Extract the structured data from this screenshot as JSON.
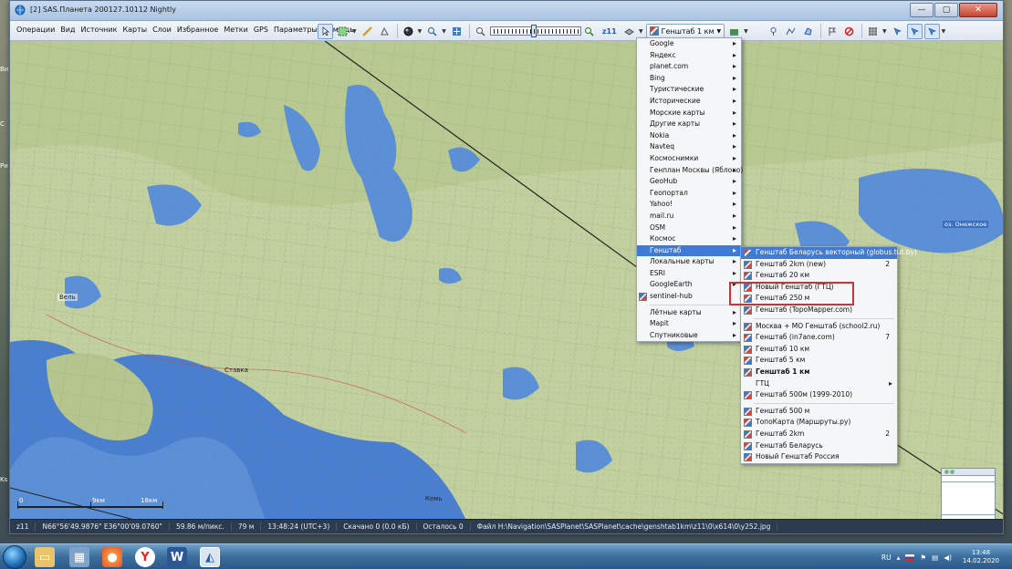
{
  "window": {
    "title": "[2] SAS.Планета 200127.10112 Nightly",
    "controls": {
      "minimize": "—",
      "maximize": "▢",
      "close": "✕"
    }
  },
  "menubar": [
    "Операции",
    "Вид",
    "Источник",
    "Карты",
    "Слои",
    "Избранное",
    "Метки",
    "GPS",
    "Параметры",
    "Помощь"
  ],
  "toolbar": {
    "zoom_label": "z11",
    "zoom_level_fraction": 0.47,
    "current_map": "Генштаб 1 км"
  },
  "desktop_edge_labels": [
    "Ви",
    "С",
    "Ри",
    "Ks"
  ],
  "map": {
    "place_labels": [
      "Вель",
      "Ставка",
      "оз. Онежское",
      "Кемь"
    ],
    "scale_labels": [
      "0",
      "9км",
      "18км"
    ],
    "colors": {
      "land": "#b8c79a",
      "water": "#5b8fd6",
      "sea": "#4a7fcf"
    }
  },
  "statusbar": [
    "z11",
    "N66°56'49.9876\" E36°00'09.0760\"",
    "59.86 м/пикс.",
    "79 м",
    "13:48:24 (UTC+3)",
    "Скачано 0 (0.0 кБ)",
    "Осталось 0",
    "Файл H:\\Navigation\\SASPlanet\\SASPlanet\\cache\\genshtab1km\\z11\\0\\x614\\0\\y252.jpg"
  ],
  "main_menu": [
    {
      "label": "Google",
      "sub": true
    },
    {
      "label": "Яндекс",
      "sub": true
    },
    {
      "label": "planet.com",
      "sub": true
    },
    {
      "label": "Bing",
      "sub": true
    },
    {
      "label": "Туристические",
      "sub": true
    },
    {
      "label": "Исторические",
      "sub": true
    },
    {
      "label": "Морские карты",
      "sub": true
    },
    {
      "label": "Другие карты",
      "sub": true
    },
    {
      "label": "Nokia",
      "sub": true
    },
    {
      "label": "Navteq",
      "sub": true
    },
    {
      "label": "Космоснимки",
      "sub": true
    },
    {
      "label": "Генплан Москвы (Яблоко)",
      "sub": true
    },
    {
      "label": "GeoHub",
      "sub": true
    },
    {
      "label": "Геопортал",
      "sub": true
    },
    {
      "label": "Yahoo!",
      "sub": true
    },
    {
      "label": "mail.ru",
      "sub": true
    },
    {
      "label": "OSM",
      "sub": true
    },
    {
      "label": "Космос",
      "sub": true
    },
    {
      "label": "Генштаб",
      "sub": true,
      "highlighted": true
    },
    {
      "label": "Локальные карты",
      "sub": true
    },
    {
      "label": "ESRI",
      "sub": true
    },
    {
      "label": "GoogleEarth",
      "sub": true
    },
    {
      "label": "sentinel-hub",
      "sub": false,
      "icon": true
    },
    {
      "separator": true
    },
    {
      "label": "Лётные карты",
      "sub": true
    },
    {
      "label": "Mapit",
      "sub": true
    },
    {
      "label": "Спутниковые",
      "sub": true
    }
  ],
  "sub_menu": [
    {
      "label": "Генштаб Беларусь векторный (globus.tut.by)",
      "highlighted": true
    },
    {
      "label": "Генштаб 2km (new)",
      "shortcut": "2"
    },
    {
      "label": "Генштаб 20 км"
    },
    {
      "label": "Новый Генштаб (ГТЦ)"
    },
    {
      "label": "Генштаб 250 м"
    },
    {
      "label": "Генштаб (TopoMapper.com)"
    },
    {
      "separator": true
    },
    {
      "label": "Москва + МО Генштаб (school2.ru)"
    },
    {
      "label": "Генштаб (in7ane.com)",
      "shortcut": "7"
    },
    {
      "label": "Генштаб 10 км"
    },
    {
      "label": "Генштаб 5 км"
    },
    {
      "label": "Генштаб 1 км",
      "bold": true
    },
    {
      "label": "ГТЦ",
      "sub": true,
      "noicon": true
    },
    {
      "label": "Генштаб 500м (1999-2010)"
    },
    {
      "separator": true
    },
    {
      "label": "Генштаб 500 м"
    },
    {
      "label": "ТопоКарта (Маршруты.ру)"
    },
    {
      "label": "Генштаб 2km",
      "shortcut": "2"
    },
    {
      "label": "Генштаб Беларусь"
    },
    {
      "label": "Новый Генштаб Россия"
    }
  ],
  "taskbar": {
    "language": "RU",
    "time": "13:48",
    "date": "14.02.2020"
  }
}
